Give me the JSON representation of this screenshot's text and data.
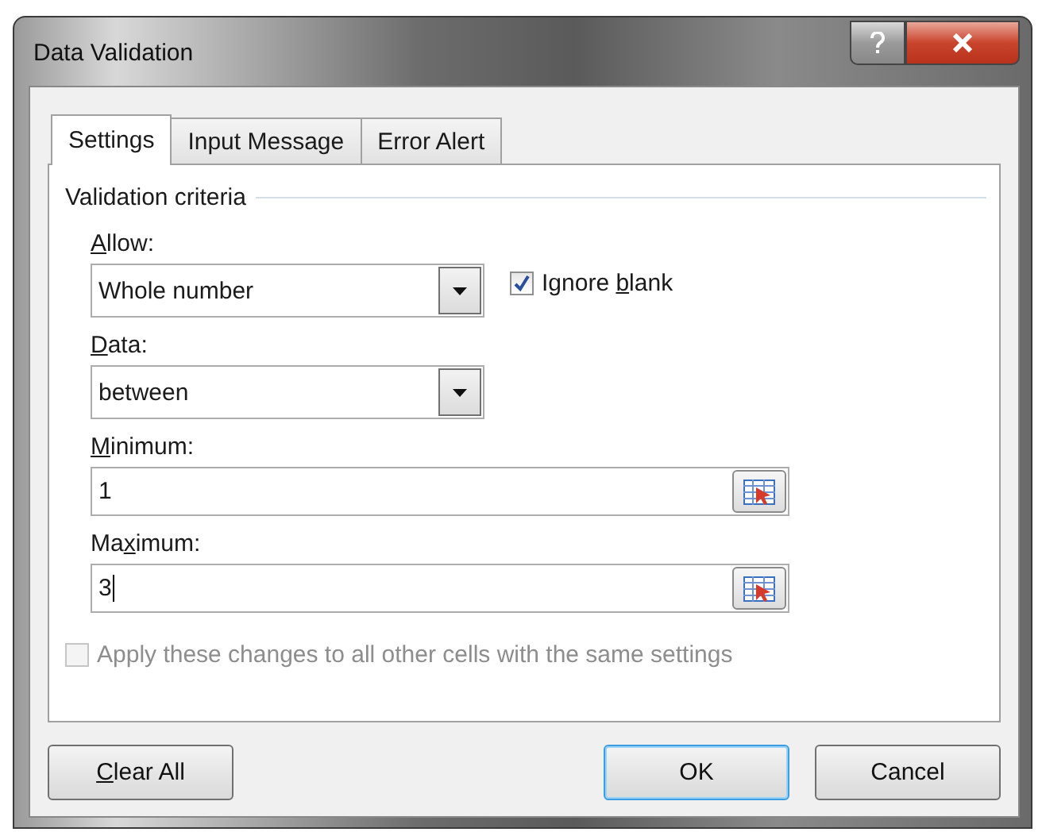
{
  "window": {
    "title": "Data Validation"
  },
  "tabs": [
    {
      "label": "Settings",
      "selected": true
    },
    {
      "label": "Input Message",
      "selected": false
    },
    {
      "label": "Error Alert",
      "selected": false
    }
  ],
  "group": {
    "title": "Validation criteria"
  },
  "allow": {
    "label": {
      "key": "A",
      "after": "llow:"
    },
    "value": "Whole number"
  },
  "ignore_blank": {
    "label": {
      "before": "Ignore ",
      "key": "b",
      "after": "lank"
    },
    "checked": true,
    "disabled": false
  },
  "data": {
    "label": {
      "key": "D",
      "after": "ata:"
    },
    "value": "between"
  },
  "minimum": {
    "label": {
      "key": "M",
      "after": "inimum:"
    },
    "value": "1",
    "focused": false
  },
  "maximum": {
    "label": {
      "before": "Ma",
      "key": "x",
      "after": "imum:"
    },
    "value": "3",
    "focused": true
  },
  "apply_all": {
    "label": {
      "before": "Apply these changes to all other cells with the same settings"
    },
    "checked": false,
    "disabled": true
  },
  "buttons": [
    {
      "label": {
        "key": "C",
        "after": "lear All"
      },
      "default": false,
      "kind": "left"
    },
    {
      "label": {
        "before": "OK"
      },
      "default": true,
      "kind": "right"
    },
    {
      "label": {
        "before": "Cancel"
      },
      "default": false,
      "kind": "right"
    }
  ]
}
